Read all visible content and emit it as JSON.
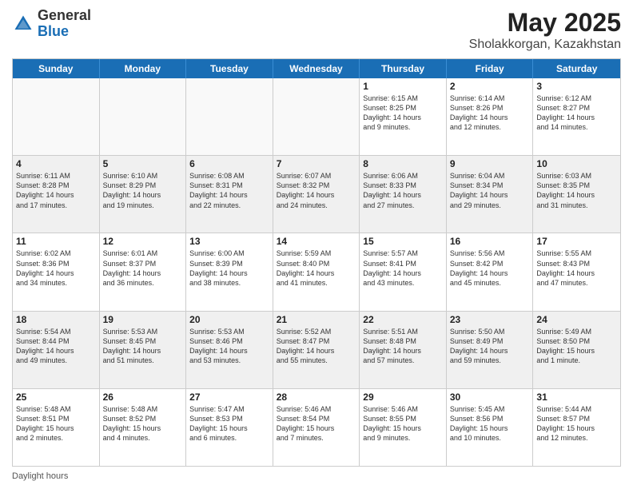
{
  "header": {
    "logo_general": "General",
    "logo_blue": "Blue",
    "month_year": "May 2025",
    "location": "Sholakkorgan, Kazakhstan"
  },
  "days_of_week": [
    "Sunday",
    "Monday",
    "Tuesday",
    "Wednesday",
    "Thursday",
    "Friday",
    "Saturday"
  ],
  "footer": {
    "daylight_label": "Daylight hours"
  },
  "weeks": [
    [
      {
        "day": "",
        "info": "",
        "empty": true
      },
      {
        "day": "",
        "info": "",
        "empty": true
      },
      {
        "day": "",
        "info": "",
        "empty": true
      },
      {
        "day": "",
        "info": "",
        "empty": true
      },
      {
        "day": "1",
        "info": "Sunrise: 6:15 AM\nSunset: 8:25 PM\nDaylight: 14 hours\nand 9 minutes.",
        "empty": false
      },
      {
        "day": "2",
        "info": "Sunrise: 6:14 AM\nSunset: 8:26 PM\nDaylight: 14 hours\nand 12 minutes.",
        "empty": false
      },
      {
        "day": "3",
        "info": "Sunrise: 6:12 AM\nSunset: 8:27 PM\nDaylight: 14 hours\nand 14 minutes.",
        "empty": false
      }
    ],
    [
      {
        "day": "4",
        "info": "Sunrise: 6:11 AM\nSunset: 8:28 PM\nDaylight: 14 hours\nand 17 minutes.",
        "empty": false
      },
      {
        "day": "5",
        "info": "Sunrise: 6:10 AM\nSunset: 8:29 PM\nDaylight: 14 hours\nand 19 minutes.",
        "empty": false
      },
      {
        "day": "6",
        "info": "Sunrise: 6:08 AM\nSunset: 8:31 PM\nDaylight: 14 hours\nand 22 minutes.",
        "empty": false
      },
      {
        "day": "7",
        "info": "Sunrise: 6:07 AM\nSunset: 8:32 PM\nDaylight: 14 hours\nand 24 minutes.",
        "empty": false
      },
      {
        "day": "8",
        "info": "Sunrise: 6:06 AM\nSunset: 8:33 PM\nDaylight: 14 hours\nand 27 minutes.",
        "empty": false
      },
      {
        "day": "9",
        "info": "Sunrise: 6:04 AM\nSunset: 8:34 PM\nDaylight: 14 hours\nand 29 minutes.",
        "empty": false
      },
      {
        "day": "10",
        "info": "Sunrise: 6:03 AM\nSunset: 8:35 PM\nDaylight: 14 hours\nand 31 minutes.",
        "empty": false
      }
    ],
    [
      {
        "day": "11",
        "info": "Sunrise: 6:02 AM\nSunset: 8:36 PM\nDaylight: 14 hours\nand 34 minutes.",
        "empty": false
      },
      {
        "day": "12",
        "info": "Sunrise: 6:01 AM\nSunset: 8:37 PM\nDaylight: 14 hours\nand 36 minutes.",
        "empty": false
      },
      {
        "day": "13",
        "info": "Sunrise: 6:00 AM\nSunset: 8:39 PM\nDaylight: 14 hours\nand 38 minutes.",
        "empty": false
      },
      {
        "day": "14",
        "info": "Sunrise: 5:59 AM\nSunset: 8:40 PM\nDaylight: 14 hours\nand 41 minutes.",
        "empty": false
      },
      {
        "day": "15",
        "info": "Sunrise: 5:57 AM\nSunset: 8:41 PM\nDaylight: 14 hours\nand 43 minutes.",
        "empty": false
      },
      {
        "day": "16",
        "info": "Sunrise: 5:56 AM\nSunset: 8:42 PM\nDaylight: 14 hours\nand 45 minutes.",
        "empty": false
      },
      {
        "day": "17",
        "info": "Sunrise: 5:55 AM\nSunset: 8:43 PM\nDaylight: 14 hours\nand 47 minutes.",
        "empty": false
      }
    ],
    [
      {
        "day": "18",
        "info": "Sunrise: 5:54 AM\nSunset: 8:44 PM\nDaylight: 14 hours\nand 49 minutes.",
        "empty": false
      },
      {
        "day": "19",
        "info": "Sunrise: 5:53 AM\nSunset: 8:45 PM\nDaylight: 14 hours\nand 51 minutes.",
        "empty": false
      },
      {
        "day": "20",
        "info": "Sunrise: 5:53 AM\nSunset: 8:46 PM\nDaylight: 14 hours\nand 53 minutes.",
        "empty": false
      },
      {
        "day": "21",
        "info": "Sunrise: 5:52 AM\nSunset: 8:47 PM\nDaylight: 14 hours\nand 55 minutes.",
        "empty": false
      },
      {
        "day": "22",
        "info": "Sunrise: 5:51 AM\nSunset: 8:48 PM\nDaylight: 14 hours\nand 57 minutes.",
        "empty": false
      },
      {
        "day": "23",
        "info": "Sunrise: 5:50 AM\nSunset: 8:49 PM\nDaylight: 14 hours\nand 59 minutes.",
        "empty": false
      },
      {
        "day": "24",
        "info": "Sunrise: 5:49 AM\nSunset: 8:50 PM\nDaylight: 15 hours\nand 1 minute.",
        "empty": false
      }
    ],
    [
      {
        "day": "25",
        "info": "Sunrise: 5:48 AM\nSunset: 8:51 PM\nDaylight: 15 hours\nand 2 minutes.",
        "empty": false
      },
      {
        "day": "26",
        "info": "Sunrise: 5:48 AM\nSunset: 8:52 PM\nDaylight: 15 hours\nand 4 minutes.",
        "empty": false
      },
      {
        "day": "27",
        "info": "Sunrise: 5:47 AM\nSunset: 8:53 PM\nDaylight: 15 hours\nand 6 minutes.",
        "empty": false
      },
      {
        "day": "28",
        "info": "Sunrise: 5:46 AM\nSunset: 8:54 PM\nDaylight: 15 hours\nand 7 minutes.",
        "empty": false
      },
      {
        "day": "29",
        "info": "Sunrise: 5:46 AM\nSunset: 8:55 PM\nDaylight: 15 hours\nand 9 minutes.",
        "empty": false
      },
      {
        "day": "30",
        "info": "Sunrise: 5:45 AM\nSunset: 8:56 PM\nDaylight: 15 hours\nand 10 minutes.",
        "empty": false
      },
      {
        "day": "31",
        "info": "Sunrise: 5:44 AM\nSunset: 8:57 PM\nDaylight: 15 hours\nand 12 minutes.",
        "empty": false
      }
    ]
  ]
}
